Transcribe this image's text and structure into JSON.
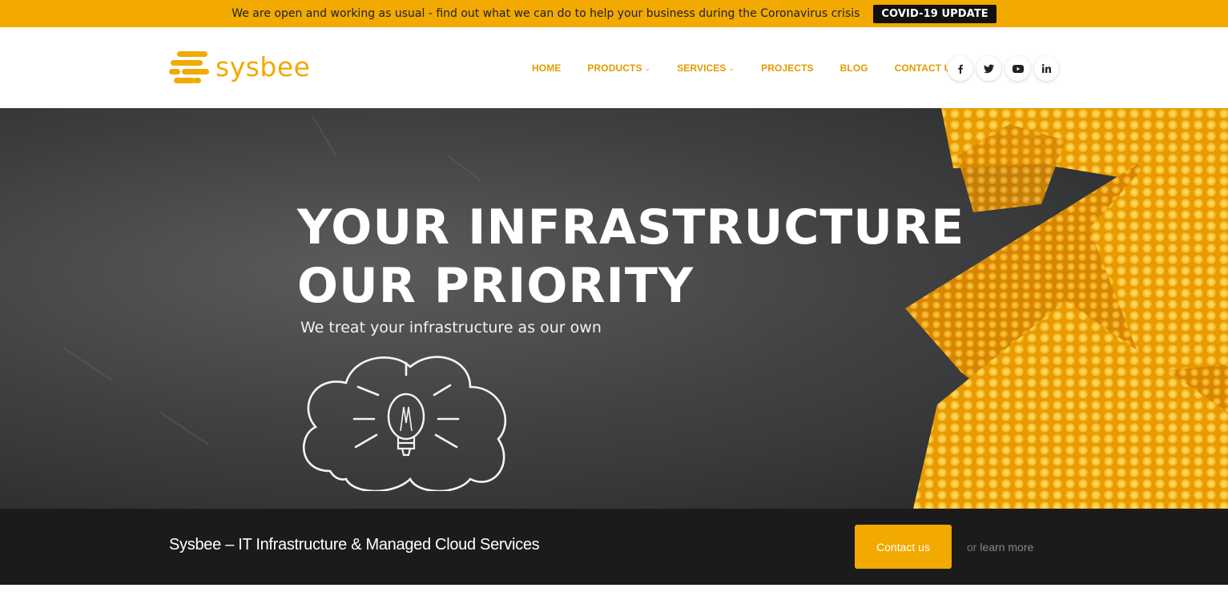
{
  "topbar": {
    "message": "We are open and working as usual - find out what we can do to help your business during the Coronavirus crisis",
    "button": "COVID-19 UPDATE"
  },
  "header": {
    "logo_text": "sysbee",
    "nav": [
      {
        "label": "HOME",
        "has_dropdown": false
      },
      {
        "label": "PRODUCTS",
        "has_dropdown": true
      },
      {
        "label": "SERVICES",
        "has_dropdown": true
      },
      {
        "label": "PROJECTS",
        "has_dropdown": false
      },
      {
        "label": "BLOG",
        "has_dropdown": false
      },
      {
        "label": "CONTACT US",
        "has_dropdown": false
      }
    ],
    "socials": [
      "facebook-icon",
      "twitter-icon",
      "youtube-icon",
      "linkedin-icon"
    ]
  },
  "hero": {
    "title_line1": "YOUR INFRASTRUCTURE",
    "title_line2": "OUR PRIORITY",
    "subtitle": "We treat your infrastructure as our own"
  },
  "cta": {
    "text": "Sysbee – IT Infrastructure & Managed Cloud Services",
    "button": "Contact us",
    "or": "or",
    "link": "learn more"
  },
  "colors": {
    "accent": "#f2a900",
    "nav": "#e39b00",
    "dark": "#1b1b1b"
  }
}
